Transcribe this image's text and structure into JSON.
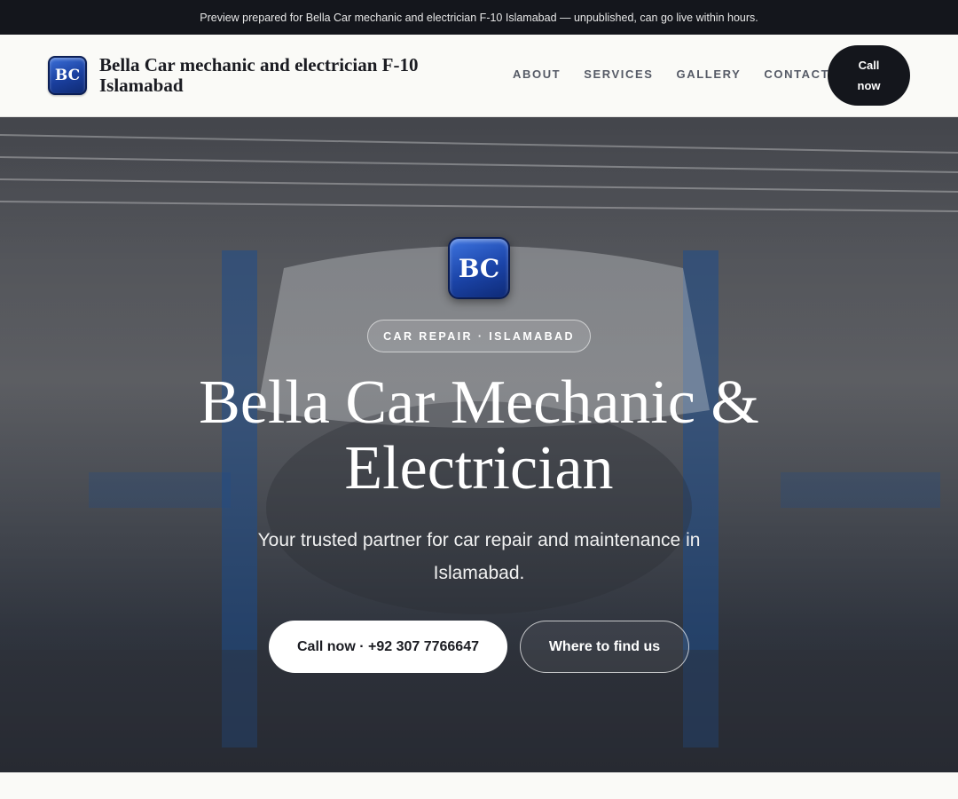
{
  "banner": {
    "text": "Preview prepared for Bella Car mechanic and electrician F-10 Islamabad — unpublished, can go live within hours."
  },
  "header": {
    "logo_text": "BC",
    "brand_name": "Bella Car mechanic and electrician F-10 Islamabad",
    "nav": [
      "ABOUT",
      "SERVICES",
      "GALLERY",
      "CONTACT"
    ],
    "call_label": "Call now"
  },
  "hero": {
    "logo_text": "BC",
    "eyebrow": "CAR REPAIR · ISLAMABAD",
    "title": "Bella Car Mechanic & Electrician",
    "subtitle": "Your trusted partner for car repair and maintenance in Islamabad.",
    "primary_button": "Call now · +92 307 7766647",
    "secondary_button": "Where to find us",
    "background_image": "car on lift in auto repair garage"
  },
  "colors": {
    "topbar": "#14161c",
    "logo_blue": "#1a3f9e",
    "text_dark": "#1b1c22",
    "page_bg": "#fafaf7"
  }
}
